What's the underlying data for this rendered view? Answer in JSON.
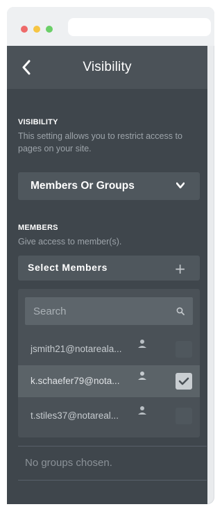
{
  "colors": {
    "red_dot": "#ee6a6a",
    "yellow_dot": "#f6c544",
    "green_dot": "#6bcf68",
    "panel_bg": "#3f464c",
    "header_bg": "#4b5258"
  },
  "header": {
    "back_icon": "chevron-left-icon",
    "title": "Visibility"
  },
  "visibility": {
    "label": "VISIBILITY",
    "description": "This setting allows you to restrict access to pages on your site.",
    "dropdown_value": "Members Or Groups",
    "dropdown_icon": "chevron-down-icon"
  },
  "members": {
    "label": "MEMBERS",
    "description": "Give access to member(s).",
    "select_label": "Select Members",
    "select_icon": "plus-icon",
    "search_placeholder": "Search",
    "search_icon": "search-icon",
    "rows": [
      {
        "email": "jsmith21@notareala...",
        "checked": false
      },
      {
        "email": "k.schaefer79@nota...",
        "checked": true
      },
      {
        "email": "t.stiles37@notareal...",
        "checked": false
      }
    ]
  },
  "groups": {
    "empty_text": "No groups chosen."
  }
}
